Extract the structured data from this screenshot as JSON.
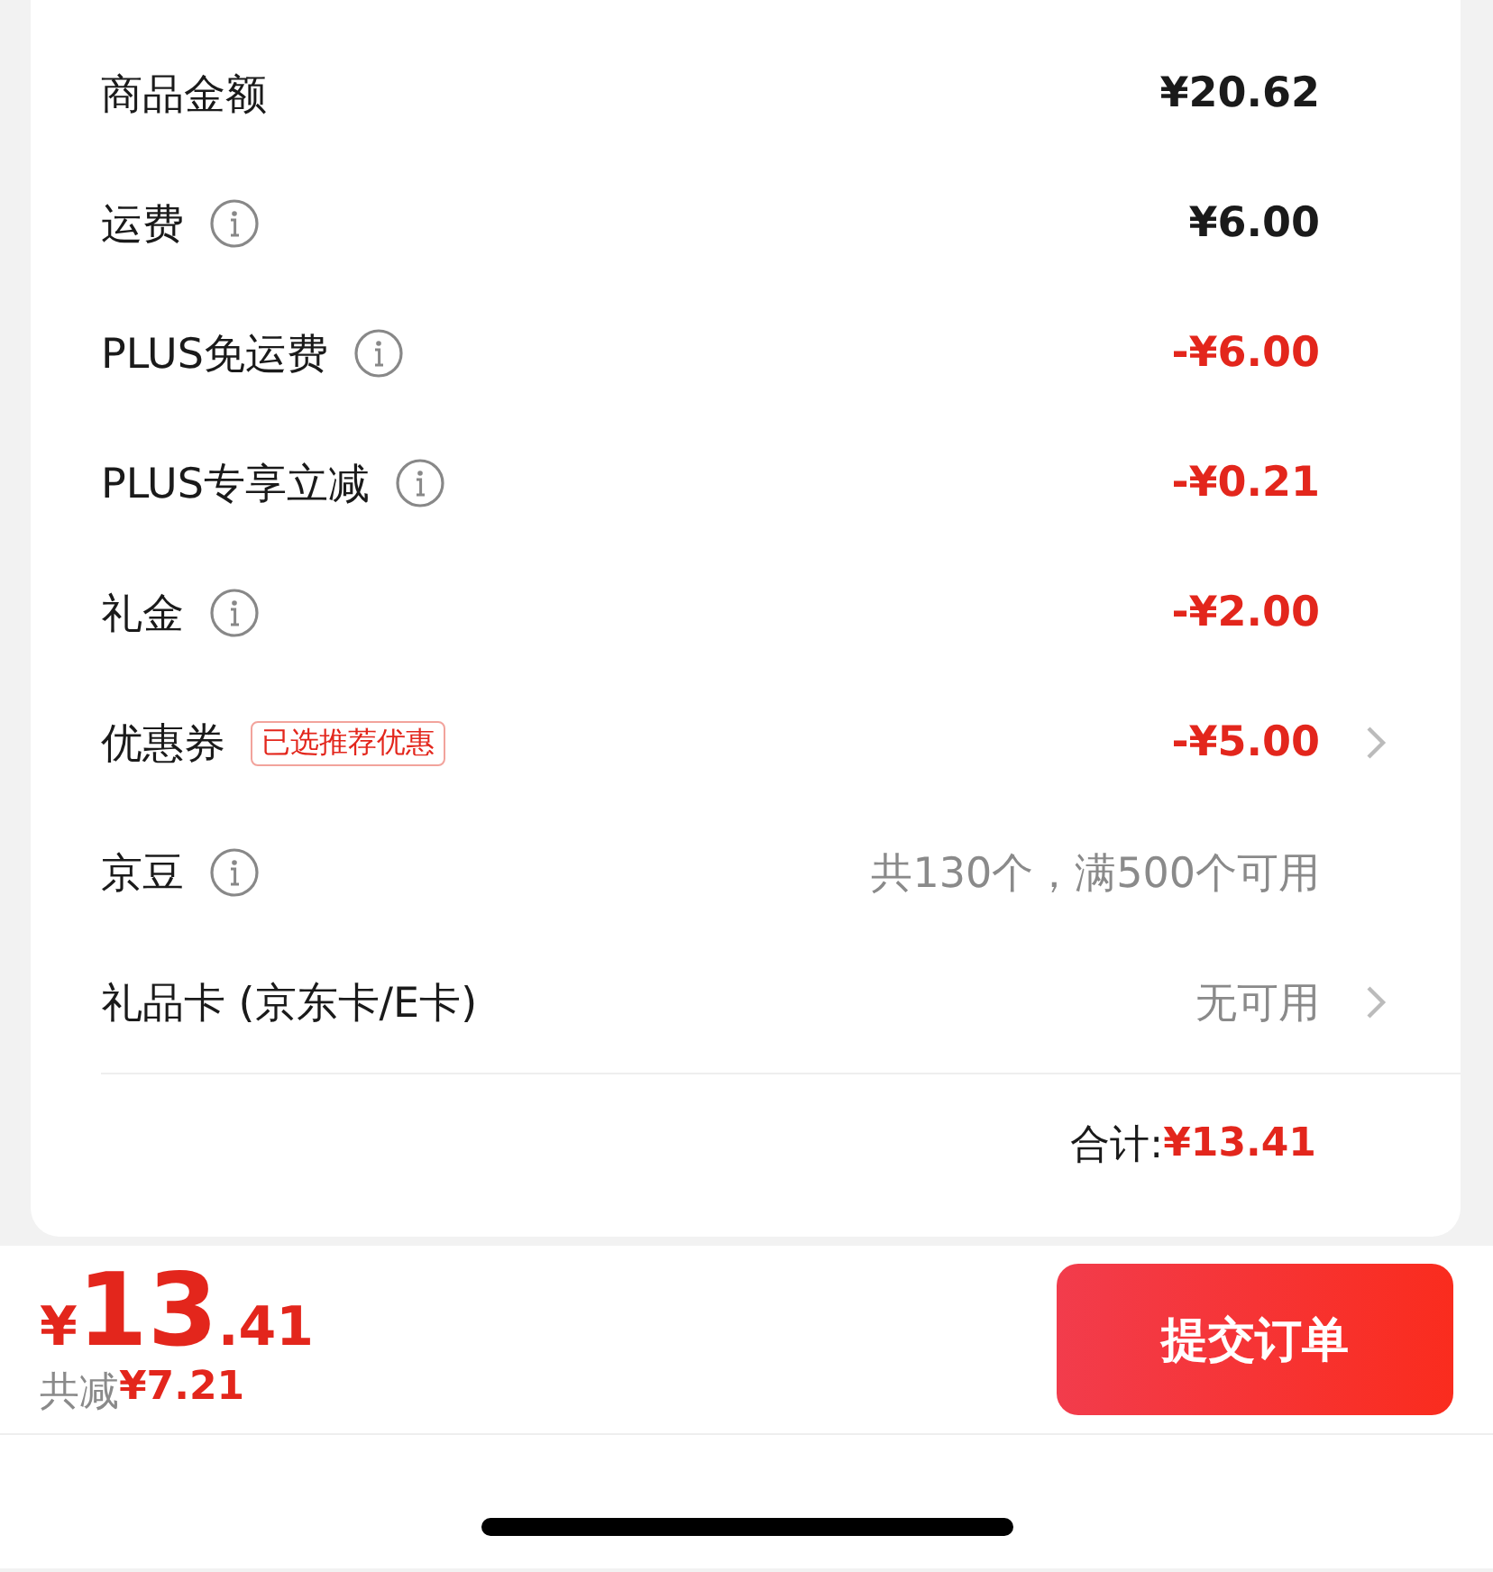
{
  "fees": [
    {
      "label": "商品金额",
      "info": false,
      "value": "¥20.62",
      "kind": "amount",
      "chevron": false
    },
    {
      "label": "运费",
      "info": true,
      "value": "¥6.00",
      "kind": "amount",
      "chevron": false
    },
    {
      "label": "PLUS免运费",
      "info": true,
      "value": "-¥6.00",
      "kind": "discount",
      "chevron": false
    },
    {
      "label": "PLUS专享立减",
      "info": true,
      "value": "-¥0.21",
      "kind": "discount",
      "chevron": false
    },
    {
      "label": "礼金",
      "info": true,
      "value": "-¥2.00",
      "kind": "discount",
      "chevron": false
    },
    {
      "label": "优惠券",
      "info": false,
      "badge": "已选推荐优惠",
      "value": "-¥5.00",
      "kind": "discount",
      "chevron": true
    },
    {
      "label": "京豆",
      "info": true,
      "value": "共130个，满500个可用",
      "kind": "note",
      "chevron": false
    },
    {
      "label": "礼品卡 (京东卡/E卡)",
      "info": false,
      "value": "无可用",
      "kind": "note",
      "chevron": true
    }
  ],
  "total": {
    "label": "合计:",
    "value": "¥13.41"
  },
  "footer": {
    "currency": "¥",
    "price_integer": "13",
    "price_decimal": ".41",
    "saved_label": "共减",
    "saved_value": "¥7.21",
    "submit": "提交订单"
  }
}
